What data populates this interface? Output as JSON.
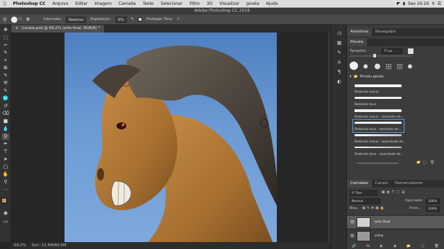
{
  "menubar": {
    "apple": "",
    "app": "Photoshop CC",
    "items": [
      "Arquivo",
      "Editar",
      "Imagem",
      "Camada",
      "Texto",
      "Selecionar",
      "Filtro",
      "3D",
      "Visualizar",
      "Janela",
      "Ajuda"
    ],
    "clock": "Sex 16:16"
  },
  "window_title": "Adobe Photoshop CC 2018",
  "options": {
    "brush_size": "77",
    "interp_label": "Intervalo:",
    "interp_value": "Realces",
    "exposure_label": "Exposição:",
    "exposure_value": "0%",
    "protect_label": "Proteger Tons"
  },
  "document_tab": "Cavalo.psd @ 69,2% (arte final, RGB/8) *",
  "status": {
    "zoom": "69,2%",
    "doc": "Doc: 11,4M/89,0M"
  },
  "panels": {
    "top_tabs": [
      "Amostras",
      "Navegador"
    ],
    "brush_tab": "Pincéis",
    "size_label": "Tamanho:",
    "size_value": "77 px",
    "group_name": "Pincéis gerais",
    "brushes": [
      "Redondo macio",
      "Redondo duro",
      "Redondo macio - tamanho de...",
      "Redondo duro - tamanho de...",
      "Redondo macio - opacidade de...",
      "Redondo duro - opacidade de..."
    ],
    "layer_tabs": [
      "Camadas",
      "Canais",
      "Demarcadores"
    ],
    "kind": "Tipo",
    "blend_mode": "Normal",
    "opacity_label": "Opacidade:",
    "opacity_value": "100%",
    "lock_label": "Bloq.:",
    "fill_label": "Preen.:",
    "fill_value": "100%",
    "layers": [
      "arte final",
      "crina"
    ]
  },
  "colors": {
    "accent": "#4a90d9",
    "canvas_bg": "#6b9ad4",
    "horse": "#b07a3c",
    "mane": "#4a3f35"
  }
}
